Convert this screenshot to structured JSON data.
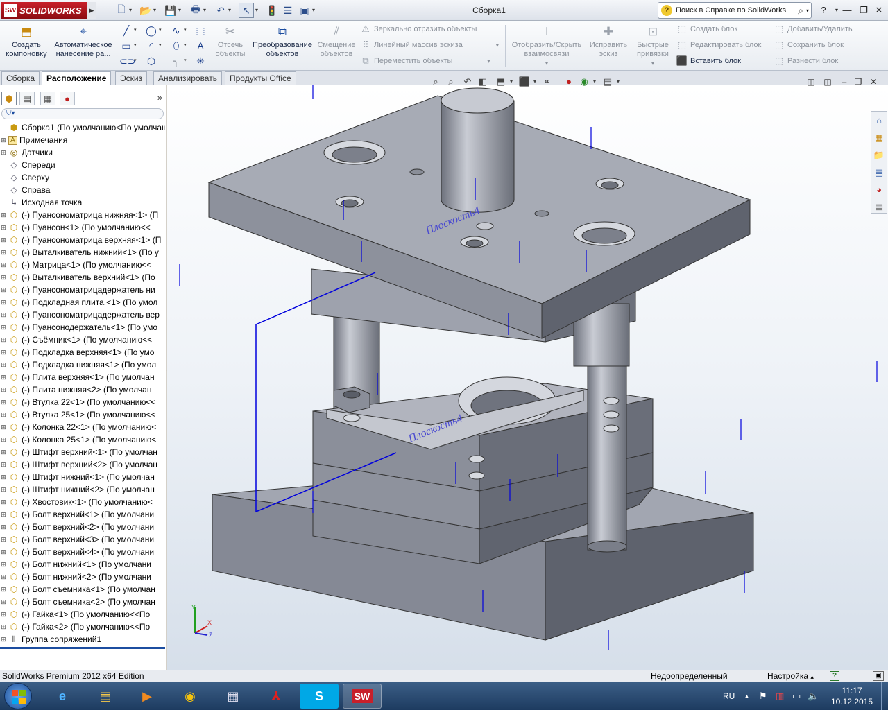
{
  "window": {
    "app_name": "SOLIDWORKS",
    "title": "Сборка1",
    "help_search_placeholder": "Поиск в Справке по SolidWorks"
  },
  "command_manager": {
    "create_layout": "Создать компоновку",
    "auto_annotate": "Автоматическое нанесение ра...",
    "offset_entities": "Отсечь объекты",
    "convert_entities": "Преобразование объектов",
    "move_entities": "Смещение объектов",
    "mirror_entities": "Зеркально отразить объекты",
    "linear_pattern": "Линейный массив эскиза",
    "move_objects": "Переместить объекты",
    "show_hide_relations": "Отобразить/Скрыть взаимосвязи",
    "repair_sketch": "Исправить эскиз",
    "quick_snaps": "Быстрые привязки",
    "create_block": "Создать блок",
    "edit_block": "Редактировать блок",
    "insert_block": "Вставить блок",
    "add_remove": "Добавить/Удалить",
    "save_block": "Сохранить блок",
    "explode_block": "Разнести блок"
  },
  "tabs": [
    {
      "label": "Сборка",
      "active": false
    },
    {
      "label": "Расположение",
      "active": true
    },
    {
      "label": "Эскиз",
      "active": false
    },
    {
      "label": "Анализировать",
      "active": false
    },
    {
      "label": "Продукты Office",
      "active": false
    }
  ],
  "feature_tree": {
    "root": "Сборка1  (По умолчанию<По умолчани",
    "items": [
      {
        "label": "Примечания",
        "icon": "annotations-icon"
      },
      {
        "label": "Датчики",
        "icon": "sensors-icon"
      },
      {
        "label": "Спереди",
        "icon": "plane-icon"
      },
      {
        "label": "Сверху",
        "icon": "plane-icon"
      },
      {
        "label": "Справа",
        "icon": "plane-icon"
      },
      {
        "label": "Исходная точка",
        "icon": "origin-icon"
      },
      {
        "label": "(-) Пуансонoматрица нижняя<1> (П",
        "icon": "part-icon"
      },
      {
        "label": "(-) Пуансон<1> (По умолчанию<<",
        "icon": "part-icon"
      },
      {
        "label": "(-) Пуансонoматрица верхняя<1> (П",
        "icon": "part-icon"
      },
      {
        "label": "(-) Выталкиватель нижний<1> (По у",
        "icon": "part-icon"
      },
      {
        "label": "(-) Матрица<1> (По умолчанию<<",
        "icon": "part-icon"
      },
      {
        "label": "(-) Выталкиватель верхний<1> (По",
        "icon": "part-icon"
      },
      {
        "label": "(-) Пуансонoматрицадержатель ни",
        "icon": "part-icon"
      },
      {
        "label": "(-) Подкладная плита.<1> (По умол",
        "icon": "part-icon"
      },
      {
        "label": "(-) Пуансонoматрицадержатель вер",
        "icon": "part-icon"
      },
      {
        "label": "(-) Пуансонодержатель<1> (По умо",
        "icon": "part-icon"
      },
      {
        "label": "(-) Съёмник<1> (По умолчанию<<",
        "icon": "part-icon"
      },
      {
        "label": "(-) Подкладка верхняя<1> (По умо",
        "icon": "part-icon"
      },
      {
        "label": "(-) Подкладка нижняя<1> (По умол",
        "icon": "part-icon"
      },
      {
        "label": "(-) Плита верхняя<1> (По умолчан",
        "icon": "part-icon"
      },
      {
        "label": "(-) Плита нижняя<2> (По умолчан",
        "icon": "part-icon"
      },
      {
        "label": "(-) Втулка 22<1> (По умолчанию<<",
        "icon": "part-icon"
      },
      {
        "label": "(-) Втулка 25<1> (По умолчанию<<",
        "icon": "part-icon"
      },
      {
        "label": "(-) Колонка 22<1> (По умолчанию<",
        "icon": "part-icon"
      },
      {
        "label": "(-) Колонка 25<1> (По умолчанию<",
        "icon": "part-icon"
      },
      {
        "label": "(-) Штифт верхний<1> (По умолчан",
        "icon": "part-icon"
      },
      {
        "label": "(-) Штифт верхний<2> (По умолчан",
        "icon": "part-icon"
      },
      {
        "label": "(-) Штифт нижний<1> (По умолчан",
        "icon": "part-icon"
      },
      {
        "label": "(-) Штифт нижний<2> (По умолчан",
        "icon": "part-icon"
      },
      {
        "label": "(-) Хвостовик<1> (По умолчанию<",
        "icon": "part-icon"
      },
      {
        "label": "(-) Болт верхний<1> (По умолчани",
        "icon": "part-icon"
      },
      {
        "label": "(-) Болт верхний<2> (По умолчани",
        "icon": "part-icon"
      },
      {
        "label": "(-) Болт верхний<3> (По умолчани",
        "icon": "part-icon"
      },
      {
        "label": "(-) Болт верхний<4> (По умолчани",
        "icon": "part-icon"
      },
      {
        "label": "(-) Болт нижний<1> (По умолчани",
        "icon": "part-icon"
      },
      {
        "label": "(-) Болт нижний<2> (По умолчани",
        "icon": "part-icon"
      },
      {
        "label": "(-) Болт съемника<1> (По умолчан",
        "icon": "part-icon"
      },
      {
        "label": "(-) Болт съемника<2> (По умолчан",
        "icon": "part-icon"
      },
      {
        "label": "(-) Гайка<1> (По умолчанию<<По",
        "icon": "part-icon"
      },
      {
        "label": "(-) Гайка<2> (По умолчанию<<По",
        "icon": "part-icon"
      },
      {
        "label": "Группа сопряжений1",
        "icon": "mates-icon"
      }
    ]
  },
  "viewport": {
    "plane_label_top": "Плоскость4",
    "plane_label_bottom": "Плоскость4",
    "triad_labels": [
      "X",
      "Y",
      "Z"
    ]
  },
  "status_bar": {
    "edition": "SolidWorks Premium 2012 x64 Edition",
    "state": "Недоопределенный",
    "settings": "Настройка"
  },
  "taskbar": {
    "language": "RU",
    "time": "11:17",
    "date": "10.12.2015"
  },
  "colors": {
    "accent": "#1c4da0",
    "sw_red": "#b01018",
    "model": "#8f939f",
    "reference_blue": "#0000dd"
  }
}
